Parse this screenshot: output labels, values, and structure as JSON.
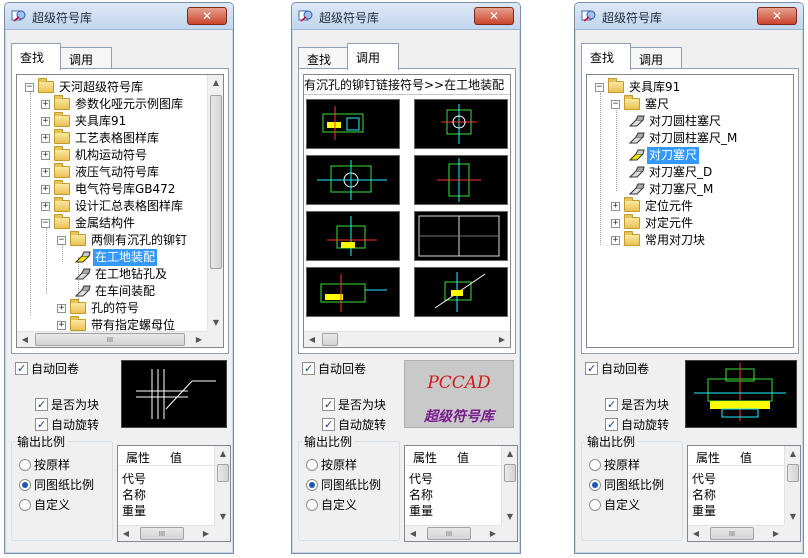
{
  "windows": [
    {
      "title": "超级符号库",
      "tabs": [
        "查找",
        "调用"
      ],
      "active_tab": 0,
      "tree": [
        {
          "pm": "−",
          "label": "天河超级符号库",
          "type": "folder"
        },
        {
          "pm": "+",
          "label": "参数化哑元示例图库",
          "type": "folder"
        },
        {
          "pm": "+",
          "label": "夹具库91",
          "type": "folder"
        },
        {
          "pm": "+",
          "label": "工艺表格图样库",
          "type": "folder"
        },
        {
          "pm": "+",
          "label": "机构运动符号",
          "type": "folder"
        },
        {
          "pm": "+",
          "label": "液压气动符号库",
          "type": "folder"
        },
        {
          "pm": "+",
          "label": "电气符号库GB472",
          "type": "folder"
        },
        {
          "pm": "+",
          "label": "设计汇总表格图样库",
          "type": "folder"
        },
        {
          "pm": "−",
          "label": "金属结构件",
          "type": "folder"
        },
        {
          "pm": "−",
          "label": "两侧有沉孔的铆钉",
          "type": "folder"
        },
        {
          "pm": "",
          "label": "在工地装配",
          "type": "symbol",
          "selected": true
        },
        {
          "pm": "",
          "label": "在工地钻孔及",
          "type": "symbol"
        },
        {
          "pm": "",
          "label": "在车间装配",
          "type": "symbol"
        },
        {
          "pm": "+",
          "label": "孔的符号",
          "type": "folder"
        },
        {
          "pm": "+",
          "label": "带有指定螺母位",
          "type": "folder"
        }
      ],
      "checks": {
        "auto_scroll": "自动回卷",
        "is_block": "是否为块",
        "auto_rotate": "自动旋转"
      },
      "scale": {
        "title": "输出比例",
        "options": [
          "按原样",
          "同图纸比例",
          "自定义"
        ],
        "selected": 1
      },
      "props": {
        "col1": "属性",
        "col2": "值",
        "rows": [
          "代号",
          "名称",
          "重量"
        ]
      },
      "hscroll_grip": "III"
    },
    {
      "title": "超级符号库",
      "tabs": [
        "查找",
        "调用"
      ],
      "active_tab": 1,
      "path": "有沉孔的铆钉链接符号>>在工地装配",
      "checks": {
        "auto_scroll": "自动回卷",
        "is_block": "是否为块",
        "auto_rotate": "自动旋转"
      },
      "logo": {
        "title": "PCCAD",
        "subtitle": "超级符号库"
      },
      "scale": {
        "title": "输出比例",
        "options": [
          "按原样",
          "同图纸比例",
          "自定义"
        ],
        "selected": 1
      },
      "props": {
        "col1": "属性",
        "col2": "值",
        "rows": [
          "代号",
          "名称",
          "重量"
        ]
      },
      "hscroll_grip": "III"
    },
    {
      "title": "超级符号库",
      "tabs": [
        "查找",
        "调用"
      ],
      "active_tab": 0,
      "tree": [
        {
          "pm": "−",
          "label": "夹具库91",
          "type": "folder"
        },
        {
          "pm": "−",
          "label": "塞尺",
          "type": "folder"
        },
        {
          "pm": "",
          "label": "对刀圆柱塞尺",
          "type": "symbol"
        },
        {
          "pm": "",
          "label": "对刀圆柱塞尺_M",
          "type": "symbol"
        },
        {
          "pm": "",
          "label": "对刀塞尺",
          "type": "symbol",
          "selected": true
        },
        {
          "pm": "",
          "label": "对刀塞尺_D",
          "type": "symbol"
        },
        {
          "pm": "",
          "label": "对刀塞尺_M",
          "type": "symbol"
        },
        {
          "pm": "+",
          "label": "定位元件",
          "type": "folder"
        },
        {
          "pm": "+",
          "label": "对定元件",
          "type": "folder"
        },
        {
          "pm": "+",
          "label": "常用对刀块",
          "type": "folder"
        }
      ],
      "checks": {
        "auto_scroll": "自动回卷",
        "is_block": "是否为块",
        "auto_rotate": "自动旋转"
      },
      "scale": {
        "title": "输出比例",
        "options": [
          "按原样",
          "同图纸比例",
          "自定义"
        ],
        "selected": 1
      },
      "props": {
        "col1": "属性",
        "col2": "值",
        "rows": [
          "代号",
          "名称",
          "重量"
        ]
      },
      "hscroll_grip": "III"
    }
  ],
  "colors": {
    "selection": "#3399ff",
    "close_button": "#c9452e",
    "cad_background": "#000000",
    "logo_red": "#d11a1a",
    "logo_purple": "#7a1d8e"
  },
  "icons": [
    "app-icon",
    "close-icon",
    "folder-icon",
    "symbol-icon",
    "expand-icon",
    "collapse-icon",
    "checkbox-icon",
    "radio-icon"
  ]
}
